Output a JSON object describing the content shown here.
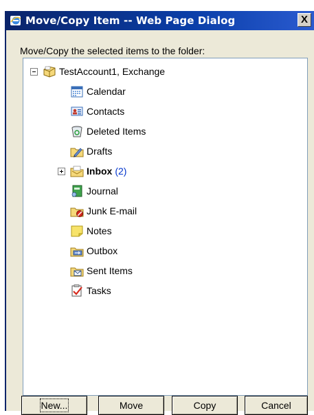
{
  "dialog": {
    "title": "Move/Copy Item -- Web Page Dialog",
    "close_label": "X",
    "prompt": "Move/Copy the selected items to the folder:"
  },
  "tree": {
    "root": {
      "label": "TestAccount1, Exchange",
      "icon": "mailbox-icon",
      "expanded": true
    },
    "folders": [
      {
        "label": "Calendar",
        "icon": "calendar-icon"
      },
      {
        "label": "Contacts",
        "icon": "contacts-icon"
      },
      {
        "label": "Deleted Items",
        "icon": "deleted-items-icon"
      },
      {
        "label": "Drafts",
        "icon": "drafts-icon"
      },
      {
        "label": "Inbox",
        "count": "(2)",
        "icon": "inbox-icon",
        "bold": true,
        "expandable": true
      },
      {
        "label": "Journal",
        "icon": "journal-icon"
      },
      {
        "label": "Junk E-mail",
        "icon": "junk-email-icon"
      },
      {
        "label": "Notes",
        "icon": "notes-icon"
      },
      {
        "label": "Outbox",
        "icon": "outbox-icon"
      },
      {
        "label": "Sent Items",
        "icon": "sent-items-icon"
      },
      {
        "label": "Tasks",
        "icon": "tasks-icon"
      }
    ]
  },
  "buttons": {
    "new": "New...",
    "move": "Move",
    "copy": "Copy",
    "cancel": "Cancel"
  },
  "colors": {
    "titlebar": "#0a246a",
    "dialog_bg": "#ece9d8",
    "inbox_count": "#0033cc"
  }
}
